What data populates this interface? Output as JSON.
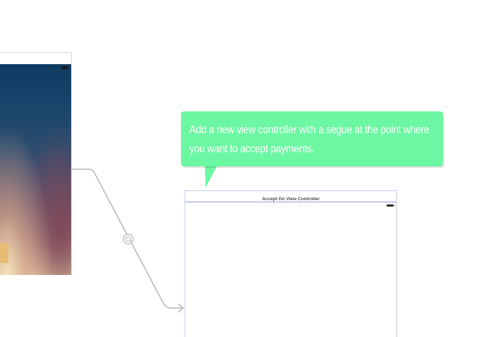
{
  "callout": {
    "text": "Add a new view controller with a segue at the point where you want to accept payments."
  },
  "target_scene": {
    "title": "Accept On View Controller"
  },
  "segue": {
    "icon": "segue-present-icon"
  },
  "colors": {
    "callout_background": "#6cf7a2",
    "scene_border": "#8f99d9",
    "segue_line": "#b5b5b5"
  }
}
